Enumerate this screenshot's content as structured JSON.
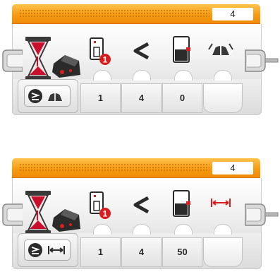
{
  "blocks": [
    {
      "header_value": "4",
      "unit_icon": "ambient-light-icon",
      "params": [
        "1",
        "4",
        "0"
      ]
    },
    {
      "header_value": "4",
      "unit_icon": "distance-cm-icon",
      "params": [
        "1",
        "4",
        "50"
      ]
    }
  ],
  "comparison_symbol": "<",
  "port_badge": "1",
  "colors": {
    "header_orange": "#f79a12",
    "badge_red": "#d81e1e",
    "sand_red": "#c8102e"
  }
}
